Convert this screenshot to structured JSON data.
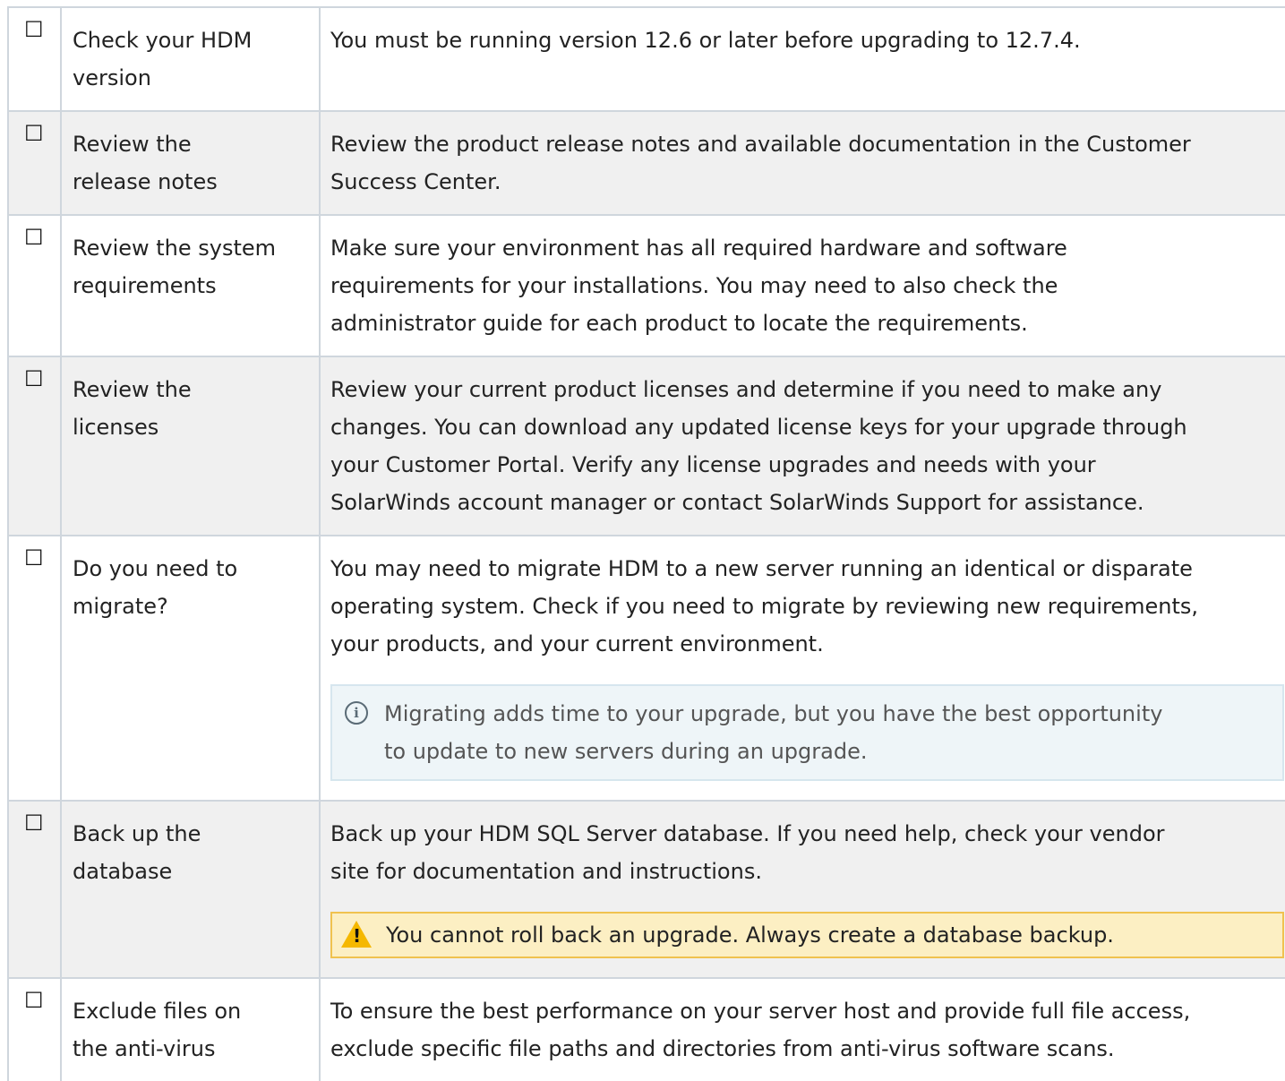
{
  "checklist": {
    "checkbox_glyph": "☐",
    "rows": [
      {
        "step": [
          "Check your HDM",
          "version"
        ],
        "desc": [
          "You must be running version 12.6 or later before upgrading to 12.7.4."
        ]
      },
      {
        "step": [
          "Review the",
          "release notes"
        ],
        "desc": [
          "Review the product release notes and available documentation in the Customer",
          "Success Center."
        ]
      },
      {
        "step": [
          "Review the system",
          "requirements"
        ],
        "desc": [
          "Make sure your environment has all required hardware and software",
          "requirements for your installations. You may need to also check the",
          "administrator guide for each product to locate the requirements."
        ]
      },
      {
        "step": [
          "Review the",
          "licenses"
        ],
        "desc": [
          "Review your current product licenses and determine if you need to make any",
          "changes. You can download any updated license keys for your upgrade through",
          "your Customer Portal. Verify any license upgrades and needs with your",
          "SolarWinds account manager or contact SolarWinds Support for assistance."
        ]
      },
      {
        "step": [
          "Do you need to",
          "migrate?"
        ],
        "desc": [
          "You may need to migrate HDM to a new server running an identical or disparate",
          "operating system. Check if you need to migrate by reviewing new requirements,",
          "your products, and your current environment."
        ],
        "note": [
          "Migrating adds time to your upgrade, but you have the best opportunity",
          "to update to new servers during an upgrade."
        ],
        "note_icon": "info-icon"
      },
      {
        "step": [
          "Back up the",
          "database"
        ],
        "desc": [
          "Back up your HDM SQL Server database. If you need help, check your vendor",
          "site for documentation and instructions."
        ],
        "warning": "You cannot roll back an upgrade. Always create a database backup.",
        "warning_icon": "warning-icon"
      },
      {
        "step": [
          "Exclude files on",
          "the anti-virus"
        ],
        "desc": [
          "To ensure the best performance on your server host and provide full file access,",
          "exclude specific file paths and directories from anti-virus software scans."
        ]
      }
    ]
  }
}
